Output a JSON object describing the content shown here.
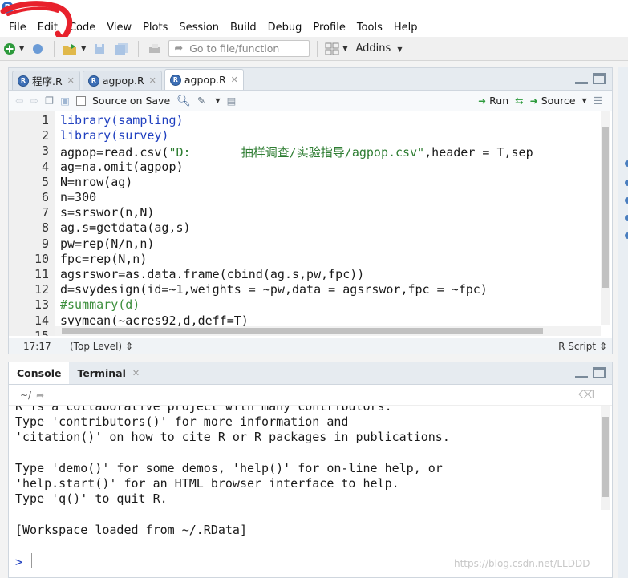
{
  "menu": [
    "File",
    "Edit",
    "Code",
    "View",
    "Plots",
    "Session",
    "Build",
    "Debug",
    "Profile",
    "Tools",
    "Help"
  ],
  "toolbar": {
    "goto_placeholder": "Go to file/function",
    "addins_label": "Addins"
  },
  "editor": {
    "tabs": [
      {
        "label": "程序.R",
        "active": false
      },
      {
        "label": "agpop.R",
        "active": false
      },
      {
        "label": "agpop.R",
        "active": true
      }
    ],
    "source_on_save": "Source on Save",
    "run_label": "Run",
    "source_label": "Source",
    "lines": [
      {
        "n": "1",
        "text": "library(sampling)"
      },
      {
        "n": "2",
        "text": "library(survey)"
      },
      {
        "n": "3",
        "pre": "agpop=read.csv(",
        "str": "\"D:       抽样调查/实验指导/agpop.csv\"",
        "post": ",header = T,sep"
      },
      {
        "n": "4",
        "text": "ag=na.omit(agpop)"
      },
      {
        "n": "5",
        "text": "N=nrow(ag)"
      },
      {
        "n": "6",
        "text": "n=300"
      },
      {
        "n": "7",
        "text": "s=srswor(n,N)"
      },
      {
        "n": "8",
        "text": "ag.s=getdata(ag,s)"
      },
      {
        "n": "9",
        "text": "pw=rep(N/n,n)"
      },
      {
        "n": "10",
        "text": "fpc=rep(N,n)"
      },
      {
        "n": "11",
        "text": "agsrswor=as.data.frame(cbind(ag.s,pw,fpc))"
      },
      {
        "n": "12",
        "text": "d=svydesign(id=~1,weights = ~pw,data = agsrswor,fpc = ~fpc)"
      },
      {
        "n": "13",
        "text": "#summary(d)"
      },
      {
        "n": "14",
        "text": "svymean(~acres92,d,deff=T)"
      },
      {
        "n": "15",
        "text": ""
      }
    ],
    "status": {
      "position": "17:17",
      "level": "(Top Level)",
      "file_type": "R Script"
    }
  },
  "console": {
    "tabs": [
      {
        "label": "Console",
        "active": true
      },
      {
        "label": "Terminal",
        "active": false
      }
    ],
    "path": "~/",
    "lines": [
      "R is a collaborative project with many contributors.",
      "Type 'contributors()' for more information and",
      "'citation()' on how to cite R or R packages in publications.",
      "",
      "Type 'demo()' for some demos, 'help()' for on-line help, or",
      "'help.start()' for an HTML browser interface to help.",
      "Type 'q()' to quit R.",
      "",
      "[Workspace loaded from ~/.RData]"
    ],
    "prompt": ">"
  },
  "watermark": "https://blog.csdn.net/LLDDD",
  "colors": {
    "keyword": "#1f3fbf",
    "string": "#2e7d32",
    "scribble": "#e8212c"
  }
}
